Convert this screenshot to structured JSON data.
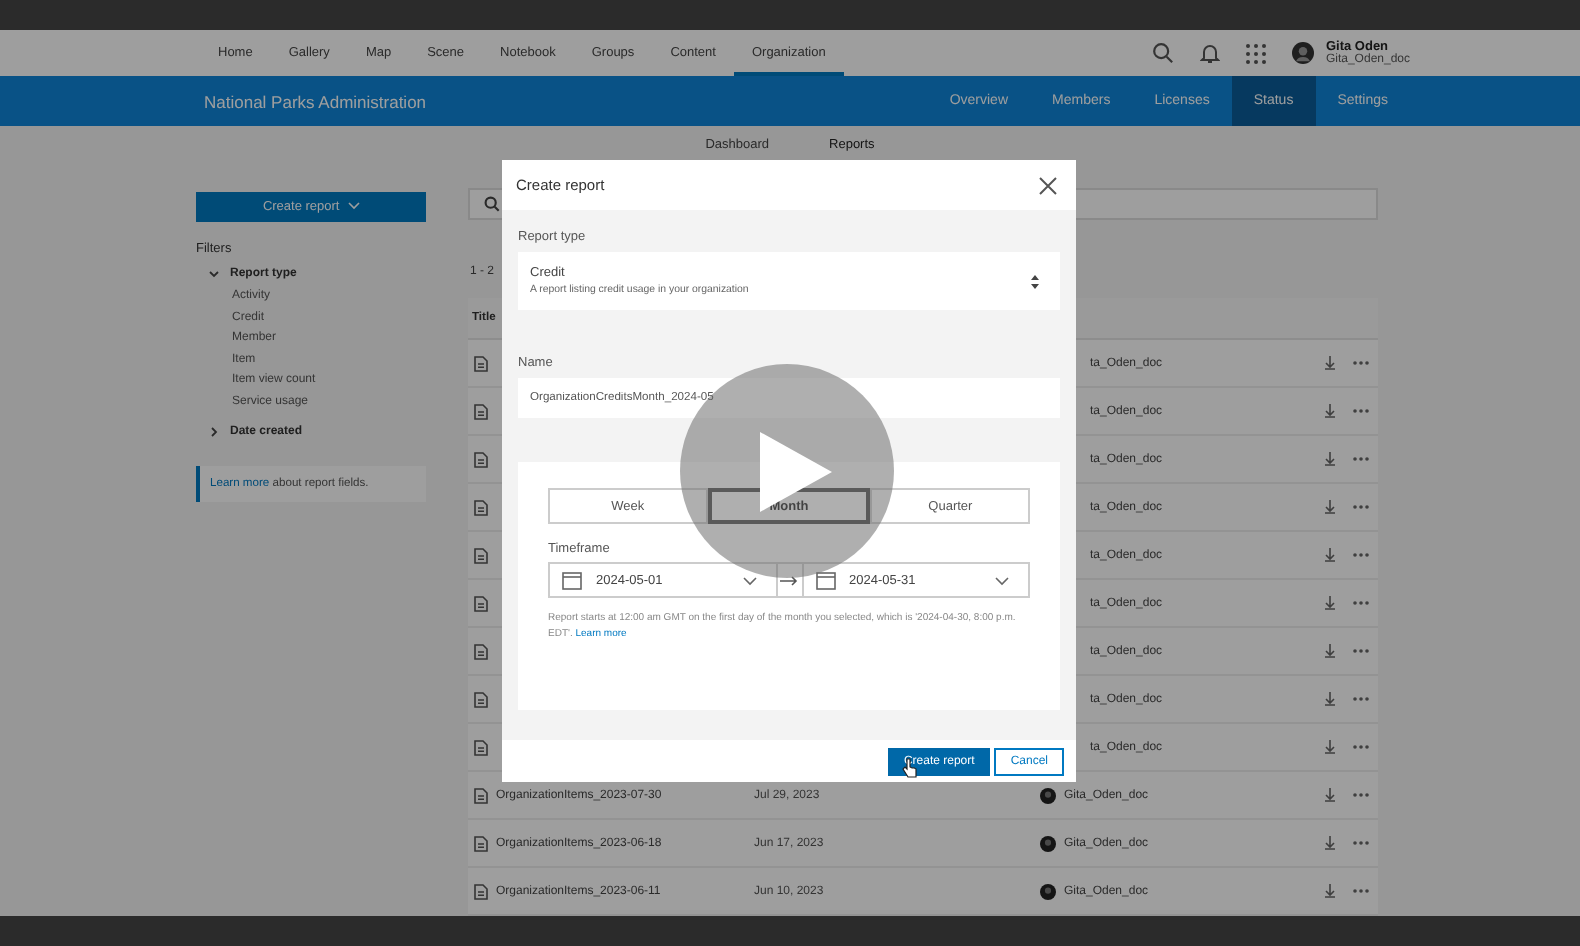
{
  "top_nav": {
    "items": [
      {
        "label": "Home",
        "selected": false
      },
      {
        "label": "Gallery",
        "selected": false
      },
      {
        "label": "Map",
        "selected": false
      },
      {
        "label": "Scene",
        "selected": false
      },
      {
        "label": "Notebook",
        "selected": false
      },
      {
        "label": "Groups",
        "selected": false
      },
      {
        "label": "Content",
        "selected": false
      },
      {
        "label": "Organization",
        "selected": true
      }
    ],
    "user": {
      "name": "Gita Oden",
      "username": "Gita_Oden_doc"
    }
  },
  "org_bar": {
    "title": "National Parks Administration",
    "tabs": [
      {
        "label": "Overview",
        "selected": false
      },
      {
        "label": "Members",
        "selected": false
      },
      {
        "label": "Licenses",
        "selected": false
      },
      {
        "label": "Status",
        "selected": true
      },
      {
        "label": "Settings",
        "selected": false
      }
    ]
  },
  "sub_tabs": [
    {
      "label": "Dashboard",
      "selected": false
    },
    {
      "label": "Reports",
      "selected": true
    }
  ],
  "sidebar": {
    "create_button": "Create report",
    "filters_title": "Filters",
    "groups": [
      {
        "label": "Report type",
        "expanded": true,
        "items": [
          "Activity",
          "Credit",
          "Member",
          "Item",
          "Item view count",
          "Service usage"
        ]
      },
      {
        "label": "Date created",
        "expanded": false
      }
    ],
    "learn_more": {
      "link": "Learn more",
      "text": "about report fields."
    }
  },
  "results": {
    "count": "1 - 2",
    "columns": [
      "Title"
    ]
  },
  "table": {
    "rows": [
      {
        "owner": "ta_Oden_doc",
        "avatar": false
      },
      {
        "owner": "ta_Oden_doc",
        "avatar": false
      },
      {
        "owner": "ta_Oden_doc",
        "avatar": false
      },
      {
        "owner": "ta_Oden_doc",
        "avatar": false
      },
      {
        "owner": "ta_Oden_doc",
        "avatar": false
      },
      {
        "owner": "ta_Oden_doc",
        "avatar": false
      },
      {
        "owner": "ta_Oden_doc",
        "avatar": false
      },
      {
        "owner": "ta_Oden_doc",
        "avatar": false
      },
      {
        "owner": "ta_Oden_doc",
        "avatar": false
      },
      {
        "title": "OrganizationItems_2023-07-30",
        "date": "Jul 29, 2023",
        "owner": "Gita_Oden_doc",
        "avatar": true
      },
      {
        "title": "OrganizationItems_2023-06-18",
        "date": "Jun 17, 2023",
        "owner": "Gita_Oden_doc",
        "avatar": true
      },
      {
        "title": "OrganizationItems_2023-06-11",
        "date": "Jun 10, 2023",
        "owner": "Gita_Oden_doc",
        "avatar": true
      }
    ]
  },
  "dialog": {
    "title": "Create report",
    "report_type_label": "Report type",
    "report_type": {
      "value": "Credit",
      "description": "A report listing credit usage in your organization"
    },
    "name_label": "Name",
    "name_value": "OrganizationCreditsMonth_2024-05",
    "periods": [
      {
        "label": "Week",
        "selected": false
      },
      {
        "label": "Month",
        "selected": true
      },
      {
        "label": "Quarter",
        "selected": false
      }
    ],
    "timeframe_label": "Timeframe",
    "start_date": "2024-05-01",
    "end_date": "2024-05-31",
    "help": {
      "text": "Report starts at 12:00 am GMT on the first day of the month you selected, which is '2024-04-30, 8:00 p.m. EDT'.",
      "link": "Learn more"
    },
    "buttons": [
      {
        "label": "Create report",
        "kind": "primary"
      },
      {
        "label": "Cancel",
        "kind": "secondary"
      }
    ]
  }
}
